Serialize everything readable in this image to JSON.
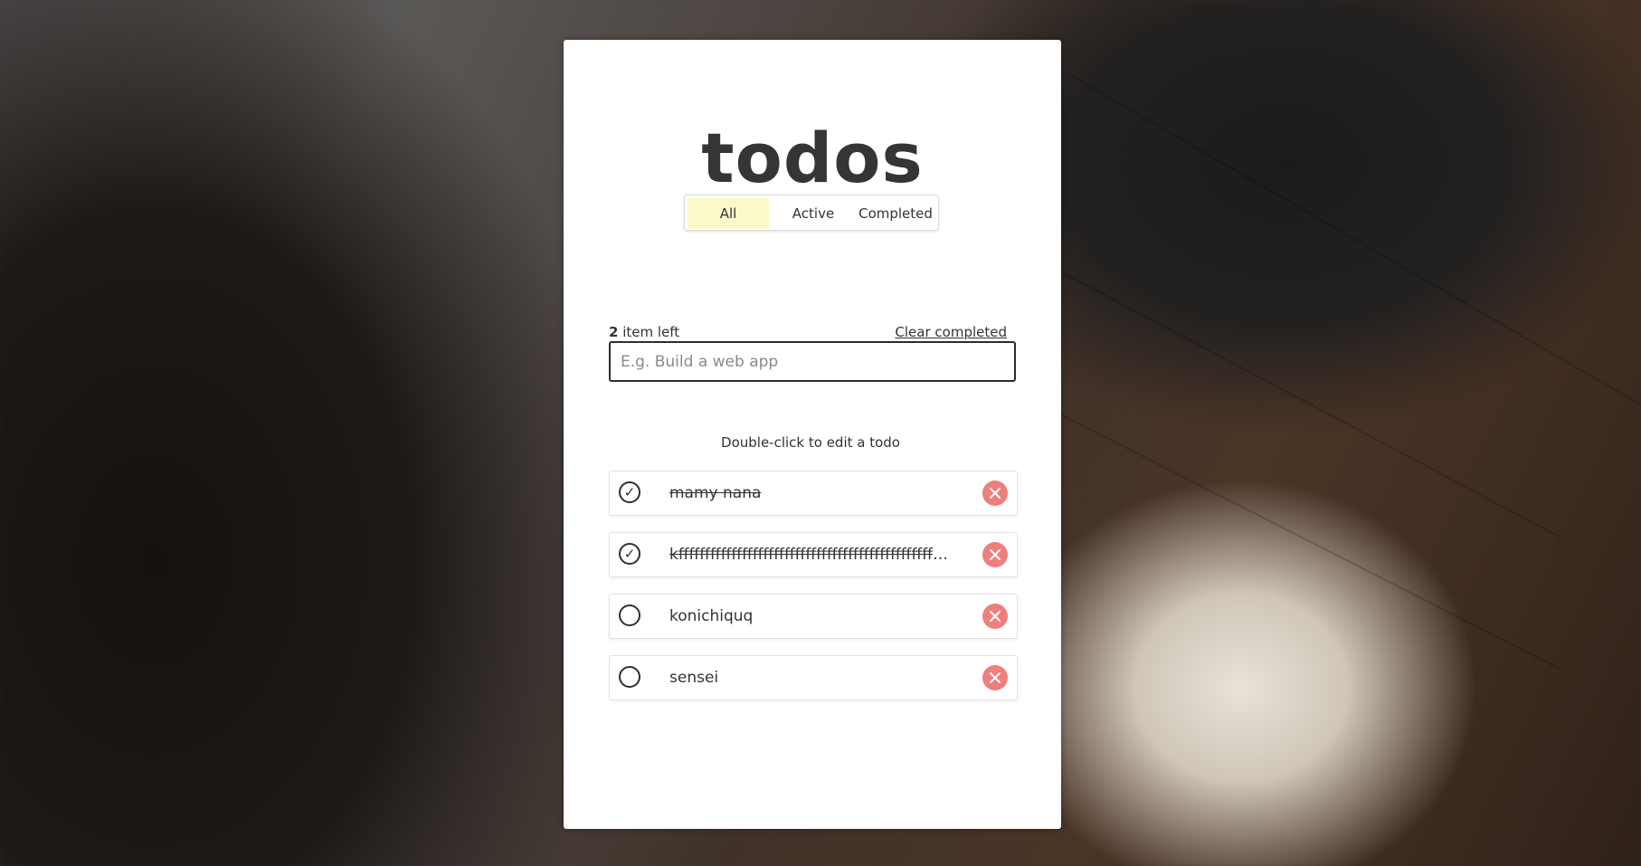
{
  "app": {
    "title": "todos"
  },
  "filters": {
    "all": "All",
    "active": "Active",
    "completed": "Completed",
    "selected": "All"
  },
  "status": {
    "count": "2",
    "count_suffix": "item left",
    "clear_completed": "Clear completed"
  },
  "new_todo": {
    "placeholder": "E.g. Build a web app",
    "value": ""
  },
  "hint": "Double-click to edit a todo",
  "todos": [
    {
      "text": "mamy nana",
      "completed": true,
      "check_icon": "✓"
    },
    {
      "text": "kffffffffffffffffffffffffffffffffffffffffffffffffffffffff",
      "completed": true,
      "check_icon": "✓"
    },
    {
      "text": "konichiquq",
      "completed": false,
      "check_icon": ""
    },
    {
      "text": "sensei",
      "completed": false,
      "check_icon": ""
    }
  ],
  "colors": {
    "accent_filter": "#fbf9c9",
    "delete": "#ee7f7b",
    "text": "#333333",
    "border": "#2d2d2d"
  },
  "icons": {
    "delete": "close-circle-icon",
    "check": "checkmark-icon"
  }
}
